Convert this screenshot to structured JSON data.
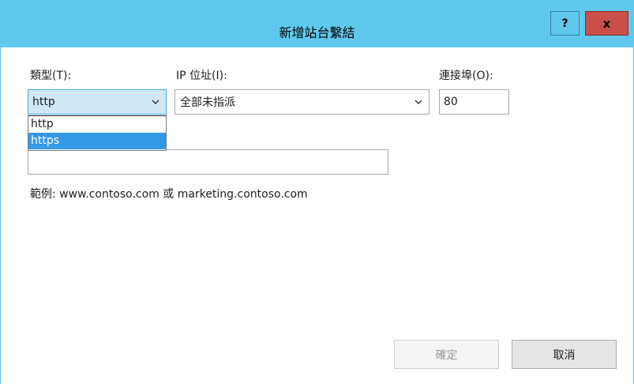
{
  "window": {
    "title": "新增站台繫結",
    "help_label": "?",
    "close_label": "x"
  },
  "form": {
    "type_label": "類型(T):",
    "type_value": "http",
    "type_options": [
      "http",
      "https"
    ],
    "type_highlighted": "https",
    "ip_label": "IP 位址(I):",
    "ip_value": "全部未指派",
    "port_label": "連接埠(O):",
    "port_value": "80",
    "host_value": "",
    "example_text": "範例: www.contoso.com 或 marketing.contoso.com"
  },
  "buttons": {
    "ok_label": "確定",
    "cancel_label": "取消"
  },
  "colors": {
    "titlebar": "#60c8ec",
    "close_button": "#c9504a",
    "selection": "#3399e6"
  },
  "icons": [
    "help-icon",
    "close-icon",
    "chevron-down-icon"
  ]
}
